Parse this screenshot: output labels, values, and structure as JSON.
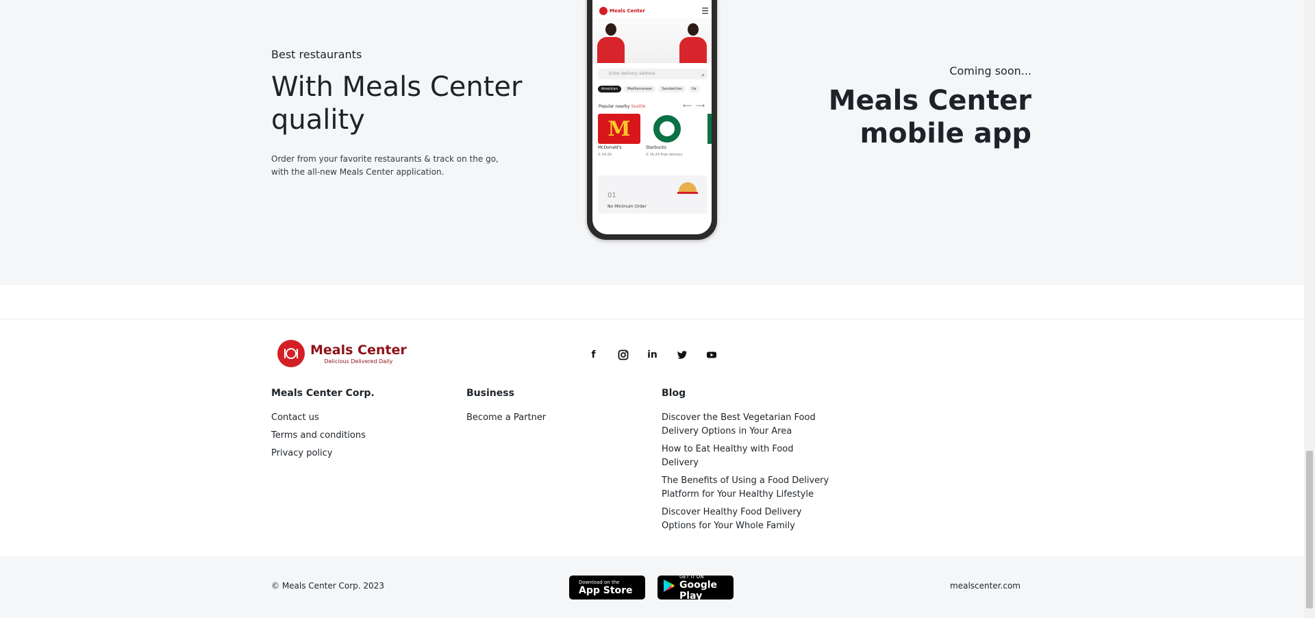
{
  "promo": {
    "left_kicker": "Best restaurants",
    "left_headline_line1": "With Meals Center",
    "left_headline_line2": "quality",
    "left_desc": "Order from your favorite restaurants & track on the go, with the all-new Meals Center application.",
    "right_kicker": "Coming soon...",
    "right_headline_line1": "Meals Center",
    "right_headline_line2": "mobile app"
  },
  "phone": {
    "brand": "Meals Center",
    "search_placeholder": "Enter delivery address",
    "tabs": [
      "American",
      "Mediterranean",
      "Sandwiches",
      "Ita"
    ],
    "popular_label": "Popular nearby",
    "popular_city": "Seattle",
    "cards": [
      {
        "name": "McDonald's",
        "meta": "⏱ 24-26",
        "logo_text": "M"
      },
      {
        "name": "Starbucks",
        "meta": "⏱ 16-24   Free delivery"
      }
    ],
    "feature_num": "01",
    "feature_label": "No Minimum Order"
  },
  "footer": {
    "logo_title": "Meals Center",
    "logo_tagline": "Delicious Delivered Daily",
    "socials": [
      "facebook-icon",
      "instagram-icon",
      "linkedin-icon",
      "twitter-icon",
      "youtube-icon"
    ],
    "columns": [
      {
        "title": "Meals Center Corp.",
        "links": [
          "Contact us",
          "Terms and conditions",
          "Privacy policy"
        ]
      },
      {
        "title": "Business",
        "links": [
          "Become a Partner"
        ]
      },
      {
        "title": "Blog",
        "links": [
          "Discover the Best Vegetarian Food Delivery Options in Your Area",
          "How to Eat Healthy with Food Delivery",
          "The Benefits of Using a Food Delivery Platform for Your Healthy Lifestyle",
          "Discover Healthy Food Delivery Options for Your Whole Family"
        ]
      }
    ],
    "copyright": "© Meals Center Corp. 2023",
    "appstore_small": "Download on the",
    "appstore_big": "App Store",
    "googleplay_small": "GET IT ON",
    "googleplay_big": "Google Play",
    "domain": "mealscenter.com"
  }
}
